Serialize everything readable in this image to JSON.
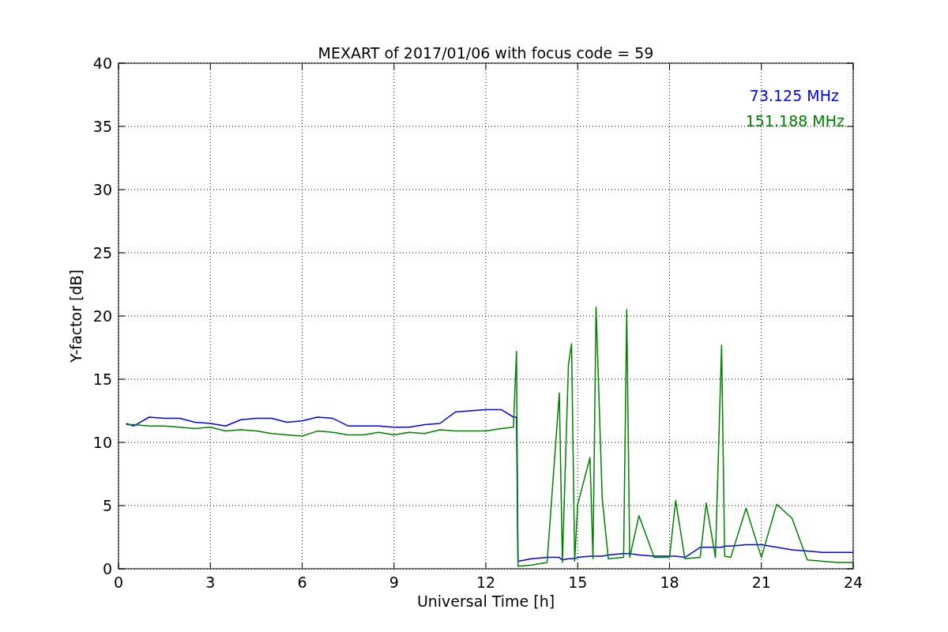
{
  "chart": {
    "chart_data": {
      "type": "line",
      "title": "MEXART of 2017/01/06 with focus code = 59",
      "xlabel": "Universal Time [h]",
      "ylabel": "Y-factor [dB]",
      "x": [
        0.25,
        0.5,
        1,
        1.5,
        2,
        2.5,
        3,
        3.5,
        4,
        4.5,
        5,
        5.5,
        6,
        6.5,
        7,
        7.5,
        8,
        8.5,
        9,
        9.5,
        10,
        10.5,
        11,
        11.5,
        12,
        12.5,
        12.9,
        13.0,
        13.05,
        13.5,
        14,
        14.4,
        14.5,
        14.7,
        14.8,
        14.9,
        15,
        15.4,
        15.5,
        15.6,
        15.8,
        16,
        16.5,
        16.6,
        16.7,
        17,
        17.5,
        18,
        18.2,
        18.5,
        19,
        19.2,
        19.5,
        19.7,
        19.8,
        20,
        20.5,
        21,
        21.5,
        22,
        22.5,
        23,
        23.5,
        24
      ],
      "series": [
        {
          "name": "73.125 MHz",
          "color": "#0000ff",
          "values": [
            11.5,
            11.3,
            12,
            11.9,
            11.9,
            11.6,
            11.5,
            11.3,
            11.8,
            11.9,
            11.9,
            11.6,
            11.7,
            12,
            11.9,
            11.3,
            11.3,
            11.3,
            11.2,
            11.2,
            11.4,
            11.5,
            12.4,
            12.5,
            12.6,
            12.6,
            12,
            12,
            0.6,
            0.8,
            0.9,
            0.9,
            0.7,
            0.8,
            0.8,
            0.8,
            0.9,
            1.0,
            1.0,
            1.0,
            1.0,
            1.1,
            1.2,
            1.2,
            1.2,
            1.1,
            1.0,
            1.0,
            1.0,
            0.9,
            1.7,
            1.7,
            1.7,
            1.7,
            1.8,
            1.8,
            1.9,
            1.9,
            1.7,
            1.5,
            1.4,
            1.3,
            1.3,
            1.3
          ]
        },
        {
          "name": "151.188 MHz",
          "color": "#008000",
          "values": [
            11.4,
            11.4,
            11.3,
            11.3,
            11.2,
            11.1,
            11.2,
            10.9,
            11.0,
            10.9,
            10.7,
            10.6,
            10.5,
            10.9,
            10.8,
            10.6,
            10.6,
            10.8,
            10.6,
            10.8,
            10.7,
            11.0,
            10.9,
            10.9,
            10.9,
            11.1,
            11.2,
            17.2,
            0.2,
            0.3,
            0.5,
            13.9,
            0.5,
            16.2,
            17.8,
            0.6,
            5.1,
            8.8,
            0.8,
            20.7,
            5.6,
            0.8,
            0.9,
            20.5,
            0.9,
            4.2,
            0.9,
            0.9,
            5.4,
            0.8,
            0.9,
            5.2,
            0.9,
            17.7,
            1.0,
            0.9,
            4.8,
            0.9,
            5.1,
            4.0,
            0.7,
            0.6,
            0.5,
            0.5
          ]
        }
      ],
      "grid": true,
      "xlim": [
        0,
        24
      ],
      "ylim": [
        0,
        40
      ],
      "xticks": [
        0,
        3,
        6,
        9,
        12,
        15,
        18,
        21,
        24
      ],
      "yticks": [
        0,
        5,
        10,
        15,
        20,
        25,
        30,
        35,
        40
      ]
    }
  }
}
